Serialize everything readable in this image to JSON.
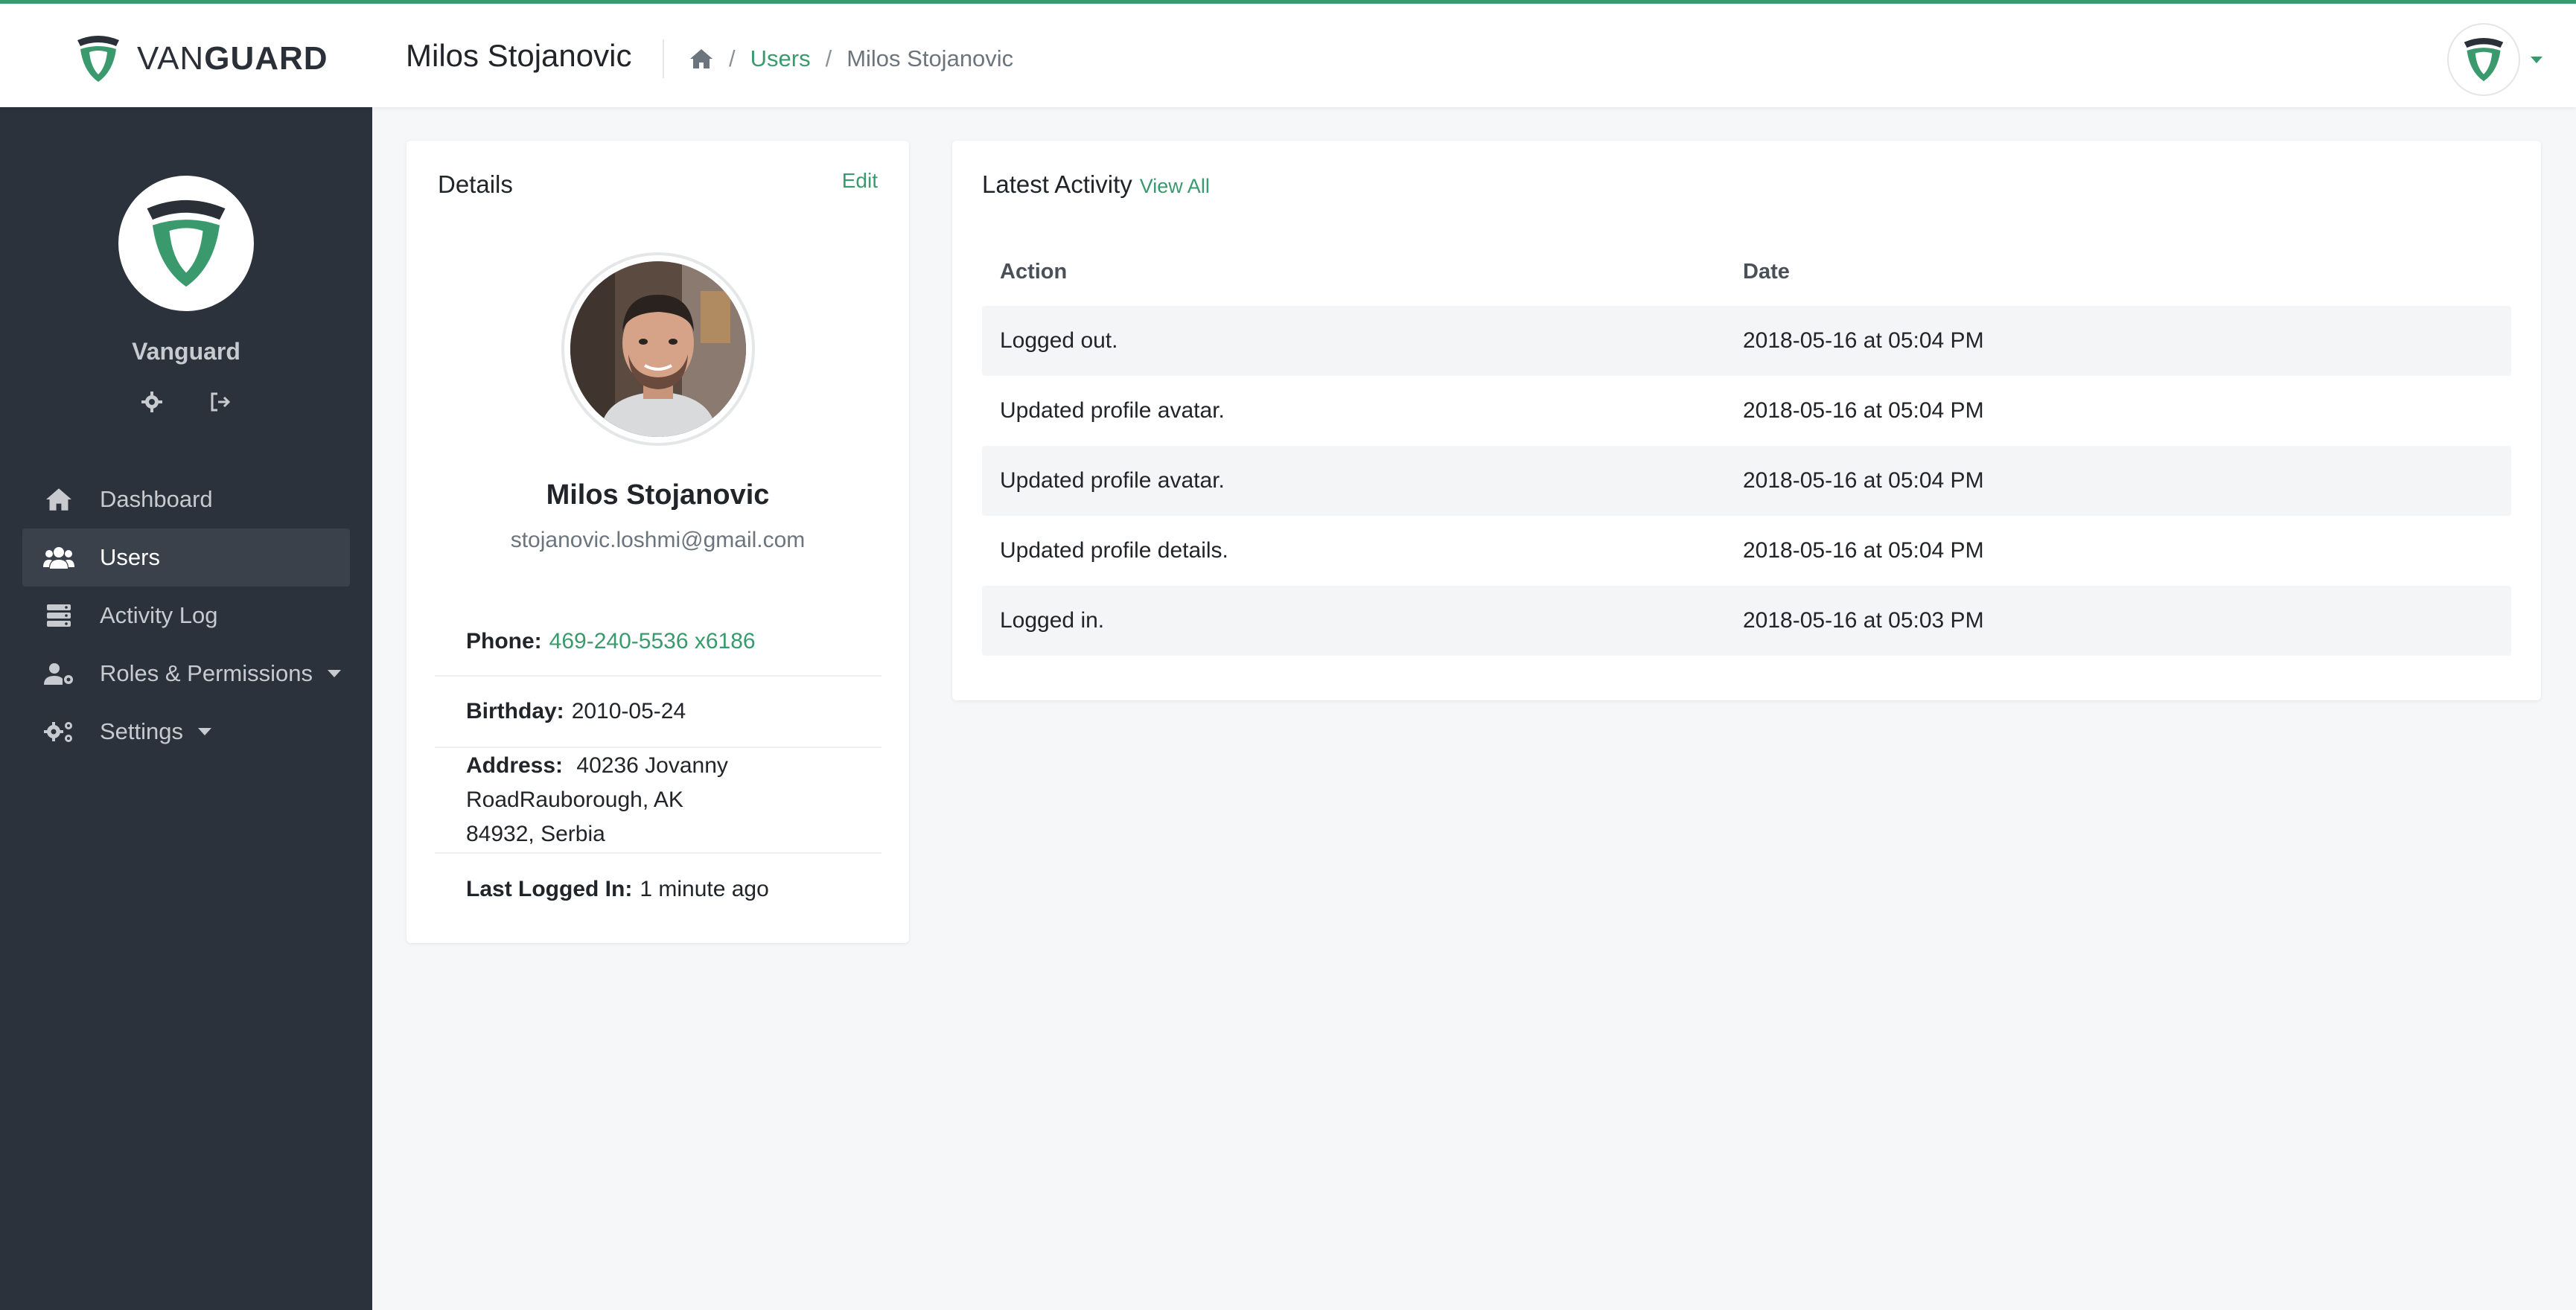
{
  "brand": {
    "van": "VAN",
    "guard": "GUARD"
  },
  "header": {
    "title": "Milos Stojanovic",
    "breadcrumb": {
      "users": "Users",
      "current": "Milos Stojanovic",
      "sep": "/"
    }
  },
  "sidebar": {
    "name": "Vanguard",
    "items": [
      {
        "label": "Dashboard",
        "icon": "home-icon"
      },
      {
        "label": "Users",
        "icon": "users-icon",
        "active": true
      },
      {
        "label": "Activity Log",
        "icon": "server-icon"
      },
      {
        "label": "Roles & Permissions",
        "icon": "user-cog-icon",
        "dropdown": true
      },
      {
        "label": "Settings",
        "icon": "cogs-icon",
        "dropdown": true
      }
    ]
  },
  "details": {
    "title": "Details",
    "edit": "Edit",
    "name": "Milos Stojanovic",
    "email": "stojanovic.loshmi@gmail.com",
    "phone_label": "Phone:",
    "phone": "469-240-5536 x6186",
    "birthday_label": "Birthday:",
    "birthday": "2010-05-24",
    "address_label": "Address:",
    "address": "40236 Jovanny RoadRauborough, AK 84932, Serbia",
    "last_label": "Last Logged In:",
    "last": "1 minute ago"
  },
  "activity": {
    "title": "Latest Activity",
    "view_all": "View All",
    "columns": [
      "Action",
      "Date"
    ],
    "rows": [
      {
        "action": "Logged out.",
        "date": "2018-05-16 at 05:04 PM"
      },
      {
        "action": "Updated profile avatar.",
        "date": "2018-05-16 at 05:04 PM"
      },
      {
        "action": "Updated profile avatar.",
        "date": "2018-05-16 at 05:04 PM"
      },
      {
        "action": "Updated profile details.",
        "date": "2018-05-16 at 05:04 PM"
      },
      {
        "action": "Logged in.",
        "date": "2018-05-16 at 05:03 PM"
      }
    ]
  },
  "colors": {
    "accent": "#3a9a6e",
    "sidebar": "#2c323b",
    "active": "#3a414b"
  }
}
